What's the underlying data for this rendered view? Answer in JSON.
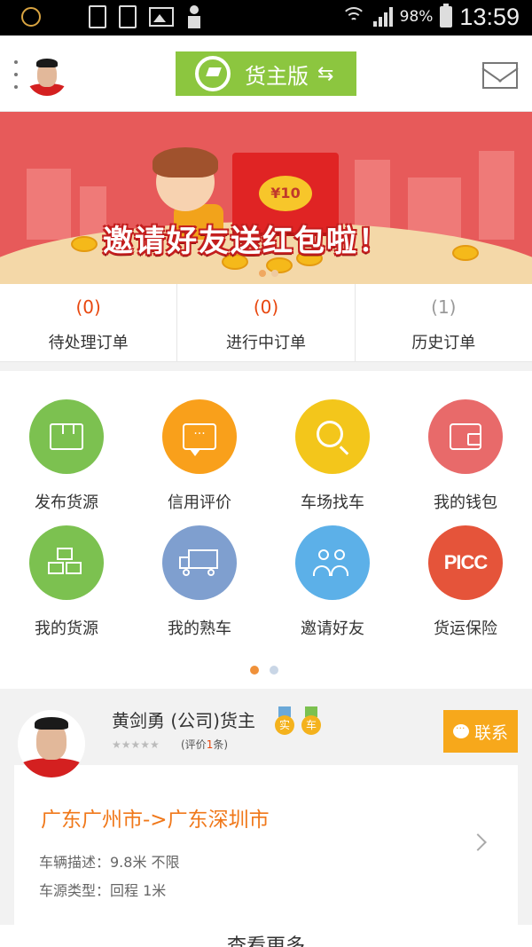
{
  "status_bar": {
    "battery": "98%",
    "time": "13:59"
  },
  "header": {
    "brand_label": "货主版",
    "swap_symbol": "⇆"
  },
  "banner": {
    "title": "邀请好友送红包啦！",
    "coin_label": "¥10"
  },
  "orders": [
    {
      "count": "(0)",
      "label": "待处理订单"
    },
    {
      "count": "(0)",
      "label": "进行中订单"
    },
    {
      "count": "(1)",
      "label": "历史订单"
    }
  ],
  "menu": [
    {
      "label": "发布货源",
      "icon": "publish-cargo-icon",
      "color": "#7cc150"
    },
    {
      "label": "信用评价",
      "icon": "credit-review-icon",
      "color": "#f9a01b"
    },
    {
      "label": "车场找车",
      "icon": "search-icon",
      "color": "#f3c61b"
    },
    {
      "label": "我的钱包",
      "icon": "wallet-icon",
      "color": "#e86a6a"
    },
    {
      "label": "我的货源",
      "icon": "my-cargo-icon",
      "color": "#7cc150"
    },
    {
      "label": "我的熟车",
      "icon": "truck-icon",
      "color": "#7f9fcf"
    },
    {
      "label": "邀请好友",
      "icon": "invite-friends-icon",
      "color": "#5cb0e8"
    },
    {
      "label": "货运保险",
      "icon": "picc-logo-icon",
      "color": "#e5543a",
      "logo_text": "PICC"
    }
  ],
  "pager": {
    "active_color": "#f0913a",
    "inactive_color": "#c9d6e6"
  },
  "shipper": {
    "name": "黄剑勇 (公司)货主",
    "badge_real": "实",
    "badge_car": "车",
    "stars": "★★★★★",
    "review_prefix": "(评价",
    "review_count": "1",
    "review_suffix": "条)",
    "contact_label": "联系",
    "route": "广东广州市->广东深圳市",
    "vehicle_desc": "车辆描述：9.8米  不限",
    "source_type": "车源类型：回程  1米"
  },
  "footer": {
    "more_label": "查看更多"
  },
  "colors": {
    "accent_orange": "#f0781a",
    "brand_green": "#8cc63f",
    "banner_red": "#e75a5a",
    "contact_orange": "#f7a81b"
  }
}
